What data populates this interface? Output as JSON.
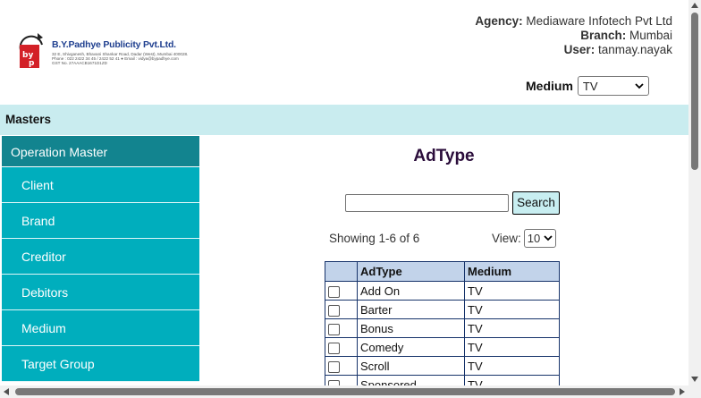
{
  "header": {
    "logo": {
      "company": "B.Y.Padhye Publicity Pvt.Ltd.",
      "address": "32 E, Shivganesh, Bhavani Shankar Road, Dadar (West), Mumbai 400028.",
      "contact": "Phone : 022 2422 34 45 / 2422 52 41  ●  Email : vidya@bypadhye.com",
      "gst": "GST No. 27AAACB1671D1ZD"
    },
    "agency_label": "Agency:",
    "agency_value": "Mediaware Infotech Pvt Ltd",
    "branch_label": "Branch:",
    "branch_value": "Mumbai",
    "user_label": "User:",
    "user_value": "tanmay.nayak",
    "medium_label": "Medium",
    "medium_value": "TV"
  },
  "masters_bar": {
    "label": "Masters"
  },
  "sidebar": {
    "heading": "Operation Master",
    "items": [
      {
        "label": "Client"
      },
      {
        "label": "Brand"
      },
      {
        "label": "Creditor"
      },
      {
        "label": "Debitors"
      },
      {
        "label": "Medium"
      },
      {
        "label": "Target Group"
      }
    ]
  },
  "main": {
    "title": "AdType",
    "search_value": "",
    "search_button": "Search",
    "showing": "Showing 1-6 of 6",
    "view_label": "View:",
    "view_value": "10",
    "table": {
      "headers": [
        "",
        "AdType",
        "Medium"
      ],
      "rows": [
        {
          "adtype": "Add On",
          "medium": "TV"
        },
        {
          "adtype": "Barter",
          "medium": "TV"
        },
        {
          "adtype": "Bonus",
          "medium": "TV"
        },
        {
          "adtype": "Comedy",
          "medium": "TV"
        },
        {
          "adtype": "Scroll",
          "medium": "TV"
        },
        {
          "adtype": "Sponsored",
          "medium": "TV"
        }
      ]
    }
  },
  "colors": {
    "masters_bar": "#c9ecef",
    "sidebar_heading": "#12848f",
    "sidebar_item": "#00aebd",
    "table_header": "#c2d3ea",
    "title": "#2b0d3b"
  }
}
